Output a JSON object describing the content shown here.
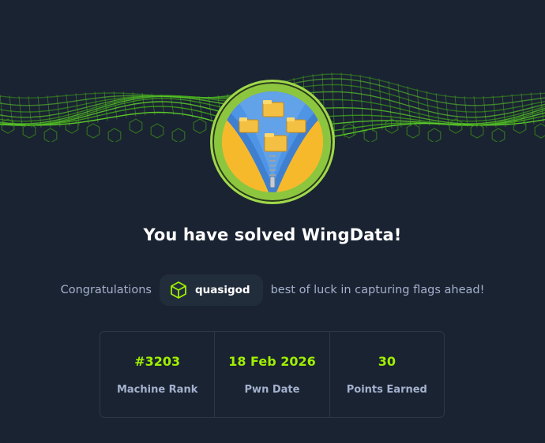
{
  "machine": {
    "headline": "You have solved WingData!",
    "avatar_icon": "zip-folder-icon"
  },
  "congrats": {
    "prefix": "Congratulations",
    "username": "quasigod",
    "suffix": "best of luck in capturing flags ahead!",
    "user_icon": "cube-icon"
  },
  "stats": [
    {
      "value": "#3203",
      "label": "Machine Rank"
    },
    {
      "value": "18 Feb 2026",
      "label": "Pwn Date"
    },
    {
      "value": "30",
      "label": "Points Earned"
    }
  ],
  "colors": {
    "background": "#1a2332",
    "accent": "#9fef00",
    "muted_text": "#a4b1cd",
    "avatar_ring": "#8cc63f",
    "avatar_fill": "#f7b92c"
  }
}
